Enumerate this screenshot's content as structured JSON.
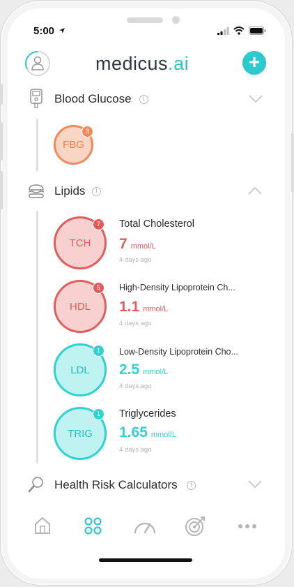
{
  "status_bar": {
    "time": "5:00"
  },
  "header": {
    "logo_main": "medicus",
    "logo_dot": ".",
    "logo_ai": "ai",
    "add_label": "+"
  },
  "sections": {
    "blood_glucose": {
      "title": "Blood Glucose",
      "expanded": false
    },
    "lipids": {
      "title": "Lipids",
      "expanded": true
    },
    "health_risk": {
      "title": "Health Risk Calculators",
      "expanded": false
    }
  },
  "metrics": {
    "fbg": {
      "code": "FBG",
      "badge": "3",
      "color": "#f08a5d"
    },
    "tch": {
      "code": "TCH",
      "badge": "7",
      "name": "Total Cholesterol",
      "value": "7",
      "unit": "mmol/L",
      "time": "4 days ago",
      "color": "#e25c5c"
    },
    "hdl": {
      "code": "HDL",
      "badge": "5",
      "name": "High-Density Lipoprotein Ch...",
      "value": "1.1",
      "unit": "mmol/L",
      "time": "4 days ago",
      "color": "#e25c5c"
    },
    "ldl": {
      "code": "LDL",
      "badge": "1",
      "name": "Low-Density Lipoprotein Cho...",
      "value": "2.5",
      "unit": "mmol/L",
      "time": "4 days ago",
      "color": "#2ed3cf"
    },
    "trig": {
      "code": "TRIG",
      "badge": "1",
      "name": "Triglycerides",
      "value": "1.65",
      "unit": "mmol/L",
      "time": "4 days ago",
      "color": "#2ed3cf"
    }
  },
  "bottom_nav": [
    {
      "icon": "home-icon",
      "active": false
    },
    {
      "icon": "dashboard-icon",
      "active": true
    },
    {
      "icon": "gauge-icon",
      "active": false
    },
    {
      "icon": "target-icon",
      "active": false
    },
    {
      "icon": "more-icon",
      "active": false
    }
  ],
  "colors": {
    "accent": "#2ec8cf",
    "warning": "#e25c5c",
    "orange": "#f08a5d"
  }
}
